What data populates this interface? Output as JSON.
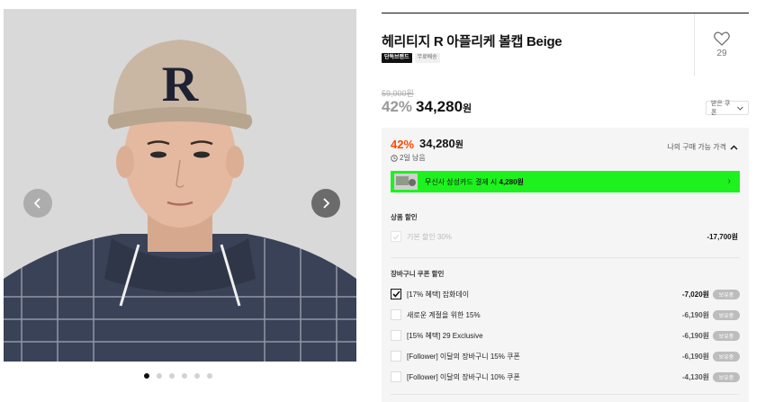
{
  "gallery": {
    "prev_icon": "chevron-left-icon",
    "next_icon": "chevron-right-icon",
    "slide_count": 6,
    "active_slide": 1
  },
  "product": {
    "title": "헤리티지 R 아플리케 볼캡 Beige",
    "tags": [
      "단독브랜드",
      "무료배송"
    ],
    "like_count": "29",
    "original_price": "59,000원",
    "discount_rate": "42%",
    "price": "34,280",
    "price_unit": "원",
    "coupon_button": "받은 쿠폰"
  },
  "benefit": {
    "rate": "42%",
    "price": "34,280",
    "unit": "원",
    "remaining": "2일 남음",
    "my_price_label": "나의 구매 가능 가격",
    "card_banner": {
      "text": "무신사 삼성카드 결제 시 ",
      "amount": "4,280원"
    },
    "product_discount": {
      "label": "상품 할인",
      "item": "기본 할인 30%",
      "amount": "-17,700원"
    },
    "cart_coupon": {
      "label": "장바구니 쿠폰 할인",
      "items": [
        {
          "label": "[17% 혜택] 잡화데이",
          "amount": "-7,020원",
          "badge": "보유중",
          "checked": true
        },
        {
          "label": "새로운 계절을 위한 15%",
          "amount": "-6,190원",
          "badge": "보유중",
          "checked": false
        },
        {
          "label": "[15% 혜택] 29 Exclusive",
          "amount": "-6,190원",
          "badge": "보유중",
          "checked": false
        },
        {
          "label": "[Follower] 이달의 장바구니 15% 쿠폰",
          "amount": "-6,190원",
          "badge": "보유중",
          "checked": false
        },
        {
          "label": "[Follower] 이달의 장바구니 10% 쿠폰",
          "amount": "-4,130원",
          "badge": "보유중",
          "checked": false
        }
      ]
    }
  },
  "colors": {
    "accent": "#ff4800",
    "card_banner": "#1ef21e",
    "badge": "#bdbdbd"
  }
}
